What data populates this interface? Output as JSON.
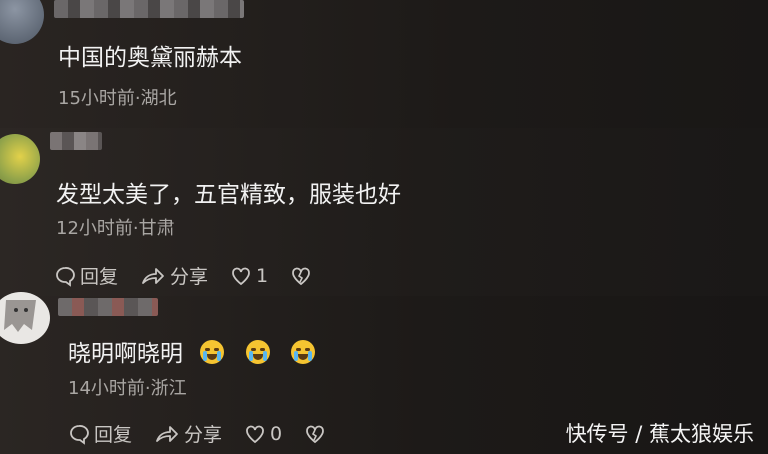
{
  "comments": [
    {
      "text": "中国的奥黛丽赫本",
      "meta": "15小时前·湖北"
    },
    {
      "text": "发型太美了，五官精致，服装也好",
      "meta": "12小时前·甘肃",
      "reply_label": "回复",
      "share_label": "分享",
      "like_count": "1"
    },
    {
      "text": "晓明啊晓明",
      "meta": "14小时前·浙江",
      "emojis": [
        "crying-emoji",
        "crying-emoji",
        "crying-emoji"
      ],
      "reply_label": "回复",
      "share_label": "分享",
      "like_count": "0"
    }
  ],
  "watermark": "快传号 / 蕉太狼娱乐",
  "icons": [
    "comment-icon",
    "share-icon",
    "heart-icon",
    "broken-heart-icon"
  ]
}
